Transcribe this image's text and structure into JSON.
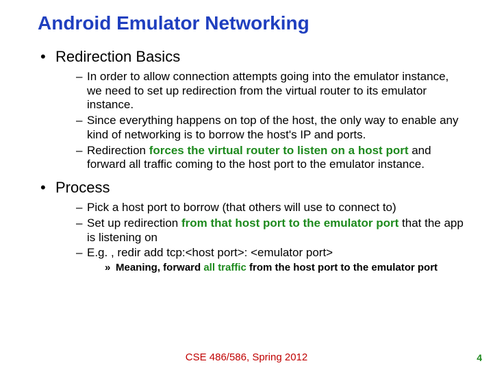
{
  "title": "Android Emulator Networking",
  "bullets": [
    {
      "label": "Redirection Basics",
      "sub": [
        {
          "text": "In order to allow connection attempts going into the emulator instance, we need to set up redirection from the virtual router to its emulator instance."
        },
        {
          "text": "Since everything happens on top of the host, the only way to enable any kind of networking is to borrow the host's IP and ports."
        },
        {
          "pre": "Redirection ",
          "em": "forces the virtual router to listen on a host port",
          "post": " and forward all traffic coming to the host port to the emulator instance."
        }
      ]
    },
    {
      "label": "Process",
      "sub": [
        {
          "text": "Pick a host port to borrow (that others will use to connect to)"
        },
        {
          "pre": "Set up redirection ",
          "em": "from that host port to the emulator port",
          "post": " that the app is listening on"
        },
        {
          "text": "E.g. , redir add tcp:<host port>: <emulator port>",
          "subsub": {
            "pre": "Meaning, forward ",
            "em": "all traffic",
            "post": " from the host port to the emulator port"
          }
        }
      ]
    }
  ],
  "footer": "CSE 486/586, Spring 2012",
  "page": "4"
}
